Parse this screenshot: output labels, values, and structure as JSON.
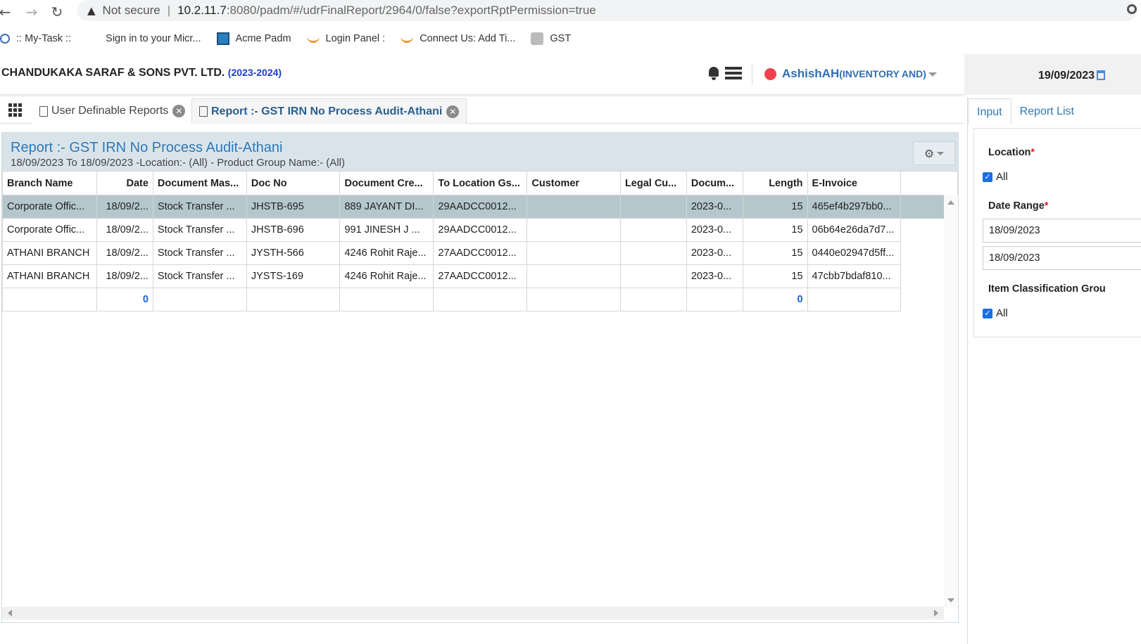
{
  "browser": {
    "security_label": "Not secure",
    "url_host": "10.2.11.7",
    "url_path": ":8080/padm/#/udrFinalReport/2964/0/false?exportRptPermission=true",
    "bookmarks": [
      {
        "label": ":: My-Task ::",
        "icon": "react-icon"
      },
      {
        "label": "Sign in to your Micr...",
        "icon": "microsoft-icon"
      },
      {
        "label": "Acme Padm",
        "icon": "app-icon"
      },
      {
        "label": "Login Panel :",
        "icon": "flame-icon"
      },
      {
        "label": "Connect Us: Add Ti...",
        "icon": "flame-icon"
      },
      {
        "label": "GST",
        "icon": "emblem-icon"
      }
    ]
  },
  "header": {
    "company": "CHANDUKAKA SARAF & SONS PVT. LTD.",
    "fiscal_year": "(2023-2024)",
    "user_name": "AshishAH",
    "user_role": "(INVENTORY AND)",
    "status_color": "#f0424e",
    "date": "19/09/2023"
  },
  "tabs": [
    {
      "label": "User Definable Reports"
    },
    {
      "label": "Report :- GST IRN No Process Audit-Athani"
    }
  ],
  "report": {
    "title": "Report :- GST IRN No Process Audit-Athani",
    "subtitle": "18/09/2023 To 18/09/2023 -Location:- (All) - Product Group Name:- (All)",
    "columns": [
      "Branch Name",
      "Date",
      "Document Mas...",
      "Doc No",
      "Document Cre...",
      "To Location Gs...",
      "Customer",
      "Legal Cu...",
      "Docum...",
      "Length",
      "E-Invoice"
    ],
    "rows": [
      [
        "Corporate Offic...",
        "18/09/2...",
        "Stock Transfer ...",
        "JHSTB-695",
        "889 JAYANT DI...",
        "29AADCC0012...",
        "",
        "",
        "2023-0...",
        "15",
        "465ef4b297bb0..."
      ],
      [
        "Corporate Offic...",
        "18/09/2...",
        "Stock Transfer ...",
        "JHSTB-696",
        "991 JINESH J ...",
        "29AADCC0012...",
        "",
        "",
        "2023-0...",
        "15",
        "06b64e26da7d7..."
      ],
      [
        "ATHANI BRANCH",
        "18/09/2...",
        "Stock Transfer ...",
        "JYSTH-566",
        "4246 Rohit Raje...",
        "27AADCC0012...",
        "",
        "",
        "2023-0...",
        "15",
        "0440e02947d5ff..."
      ],
      [
        "ATHANI BRANCH",
        "18/09/2...",
        "Stock Transfer ...",
        "JYSTS-169",
        "4246 Rohit Raje...",
        "27AADCC0012...",
        "",
        "",
        "2023-0...",
        "15",
        "47cbb7bdaf810..."
      ]
    ],
    "totals": {
      "date": "0",
      "length": "0"
    }
  },
  "side": {
    "tab_input": "Input",
    "tab_report_list": "Report List",
    "location_label": "Location",
    "location_all": "All",
    "date_range_label": "Date Range",
    "date_from": "18/09/2023",
    "date_to": "18/09/2023",
    "item_class_label": "Item Classification Grou",
    "item_class_all": "All",
    "required_mark": "*"
  }
}
